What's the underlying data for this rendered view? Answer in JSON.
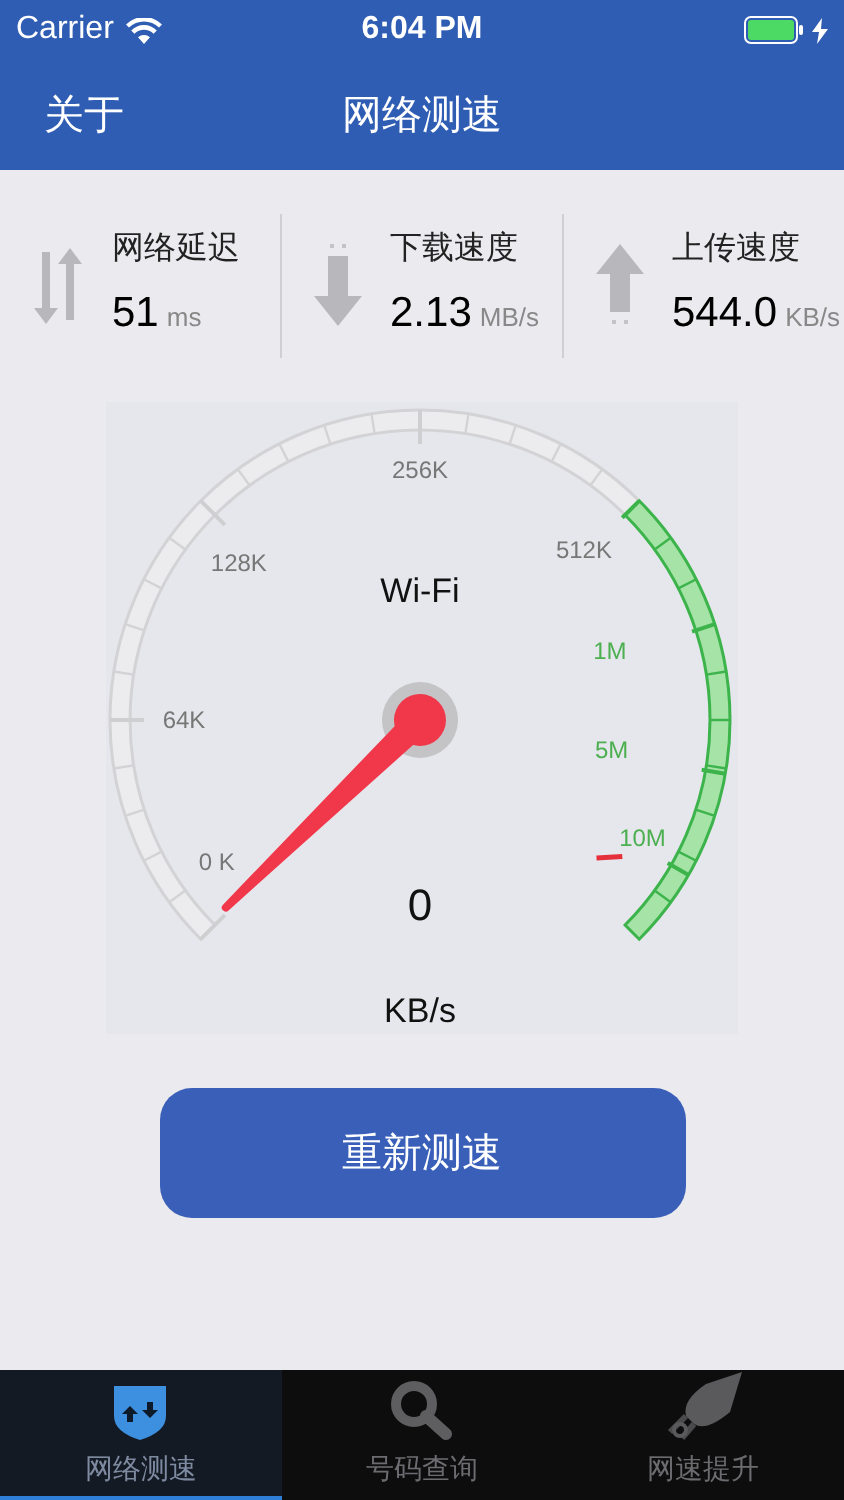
{
  "status_bar": {
    "carrier": "Carrier",
    "time": "6:04 PM"
  },
  "nav": {
    "left_button": "关于",
    "title": "网络测速"
  },
  "stats": [
    {
      "kind": "latency",
      "label": "网络延迟",
      "value": "51",
      "unit": "ms"
    },
    {
      "kind": "download",
      "label": "下载速度",
      "value": "2.13",
      "unit": "MB/s"
    },
    {
      "kind": "upload",
      "label": "上传速度",
      "value": "544.0",
      "unit": "KB/s"
    }
  ],
  "gauge": {
    "network": "Wi-Fi",
    "reading": "0",
    "unit": "KB/s",
    "scale_labels": [
      "0 K",
      "64K",
      "128K",
      "256K",
      "512K",
      "1M",
      "5M",
      "10M"
    ]
  },
  "retest_button": "重新测速",
  "tabs": [
    {
      "kind": "speed",
      "label": "网络测速",
      "selected": true
    },
    {
      "kind": "lookup",
      "label": "号码查询",
      "selected": false
    },
    {
      "kind": "boost",
      "label": "网速提升",
      "selected": false
    }
  ]
}
